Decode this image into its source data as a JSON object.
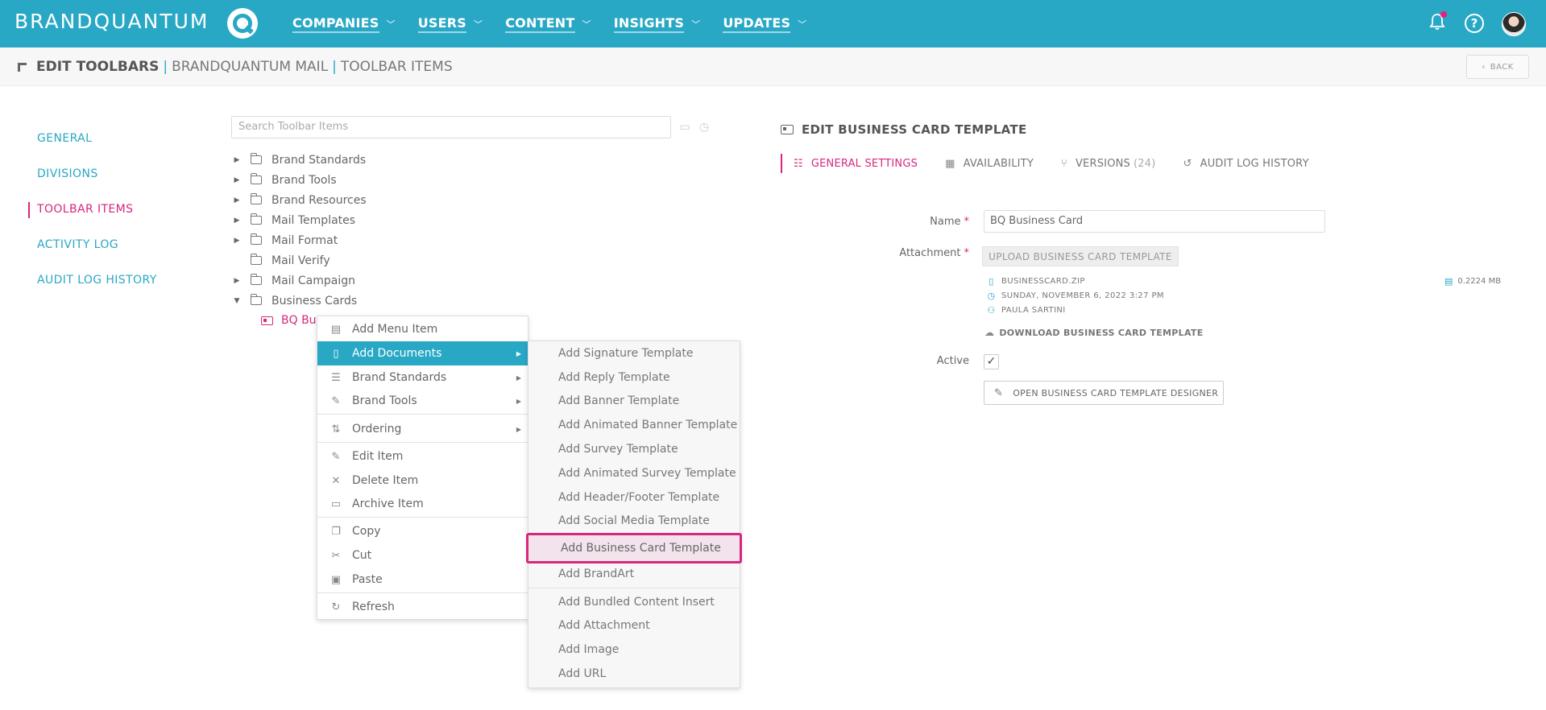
{
  "brand": {
    "name": "BRANDQUANTUM"
  },
  "nav": [
    {
      "label": "COMPANIES"
    },
    {
      "label": "USERS"
    },
    {
      "label": "CONTENT"
    },
    {
      "label": "INSIGHTS"
    },
    {
      "label": "UPDATES"
    }
  ],
  "topicons": {
    "help": "?"
  },
  "breadcrumb": {
    "part1": "EDIT TOOLBARS",
    "separator": "|",
    "part2": "BRANDQUANTUM MAIL",
    "part3": "TOOLBAR ITEMS"
  },
  "back_label": "BACK",
  "sidebar": {
    "items": [
      {
        "label": "GENERAL"
      },
      {
        "label": "DIVISIONS"
      },
      {
        "label": "TOOLBAR ITEMS",
        "active": true
      },
      {
        "label": "ACTIVITY LOG"
      },
      {
        "label": "AUDIT LOG HISTORY"
      }
    ]
  },
  "search": {
    "placeholder": "Search Toolbar Items"
  },
  "tree": {
    "items": [
      {
        "label": "Brand Standards",
        "toggle": "▶"
      },
      {
        "label": "Brand Tools",
        "toggle": "▶"
      },
      {
        "label": "Brand Resources",
        "toggle": "▶"
      },
      {
        "label": "Mail Templates",
        "toggle": "▶"
      },
      {
        "label": "Mail Format",
        "toggle": "▶"
      },
      {
        "label": "Mail Verify",
        "toggle": ""
      },
      {
        "label": "Mail Campaign",
        "toggle": "▶"
      },
      {
        "label": "Business Cards",
        "toggle": "▼"
      }
    ],
    "child": {
      "label": "BQ Bu"
    }
  },
  "context_menu": {
    "items": [
      {
        "label": "Add Menu Item",
        "icon": "▤"
      },
      {
        "label": "Add Documents",
        "icon": "▯",
        "arrow": "▶"
      },
      {
        "label": "Brand Standards",
        "icon": "☰",
        "arrow": "▶"
      },
      {
        "label": "Brand Tools",
        "icon": "✎",
        "arrow": "▶"
      },
      {
        "label": "Ordering",
        "icon": "⇅",
        "arrow": "▶"
      },
      {
        "label": "Edit Item",
        "icon": "✎"
      },
      {
        "label": "Delete Item",
        "icon": "✕"
      },
      {
        "label": "Archive Item",
        "icon": "▭"
      },
      {
        "label": "Copy",
        "icon": "❐"
      },
      {
        "label": "Cut",
        "icon": "✂"
      },
      {
        "label": "Paste",
        "icon": "▣"
      },
      {
        "label": "Refresh",
        "icon": "↻"
      }
    ]
  },
  "submenu": {
    "items": [
      {
        "label": "Add Signature Template"
      },
      {
        "label": "Add Reply Template"
      },
      {
        "label": "Add Banner Template"
      },
      {
        "label": "Add Animated Banner Template"
      },
      {
        "label": "Add Survey Template"
      },
      {
        "label": "Add Animated Survey Template"
      },
      {
        "label": "Add Header/Footer Template"
      },
      {
        "label": "Add Social Media Template"
      },
      {
        "label": "Add Business Card Template"
      },
      {
        "label": "Add BrandArt"
      },
      {
        "label": "Add Bundled Content Insert"
      },
      {
        "label": "Add Attachment"
      },
      {
        "label": "Add Image"
      },
      {
        "label": "Add URL"
      }
    ]
  },
  "editor": {
    "title": "EDIT BUSINESS CARD TEMPLATE",
    "tabs": [
      {
        "label": "GENERAL SETTINGS",
        "icon": "☷"
      },
      {
        "label": "AVAILABILITY",
        "icon": "▦"
      },
      {
        "label": "VERSIONS",
        "count": "(24)",
        "icon": "⑂"
      },
      {
        "label": "AUDIT LOG HISTORY",
        "icon": "↺"
      }
    ],
    "name_label": "Name",
    "required_mark": "*",
    "name_value": "BQ Business Card",
    "attachment_label": "Attachment",
    "upload_label": "UPLOAD BUSINESS CARD TEMPLATE",
    "file": {
      "name": "BUSINESSCARD.ZIP",
      "date": "SUNDAY, NOVEMBER 6, 2022 3:27 PM",
      "user": "PAULA SARTINI",
      "size": "0.2224 MB"
    },
    "download_label": "DOWNLOAD BUSINESS CARD TEMPLATE",
    "active_label": "Active",
    "active_checked": "✓",
    "designer_label": "OPEN BUSINESS CARD TEMPLATE DESIGNER"
  },
  "colors": {
    "brand": "#29a8c6",
    "accent": "#d8277d"
  }
}
